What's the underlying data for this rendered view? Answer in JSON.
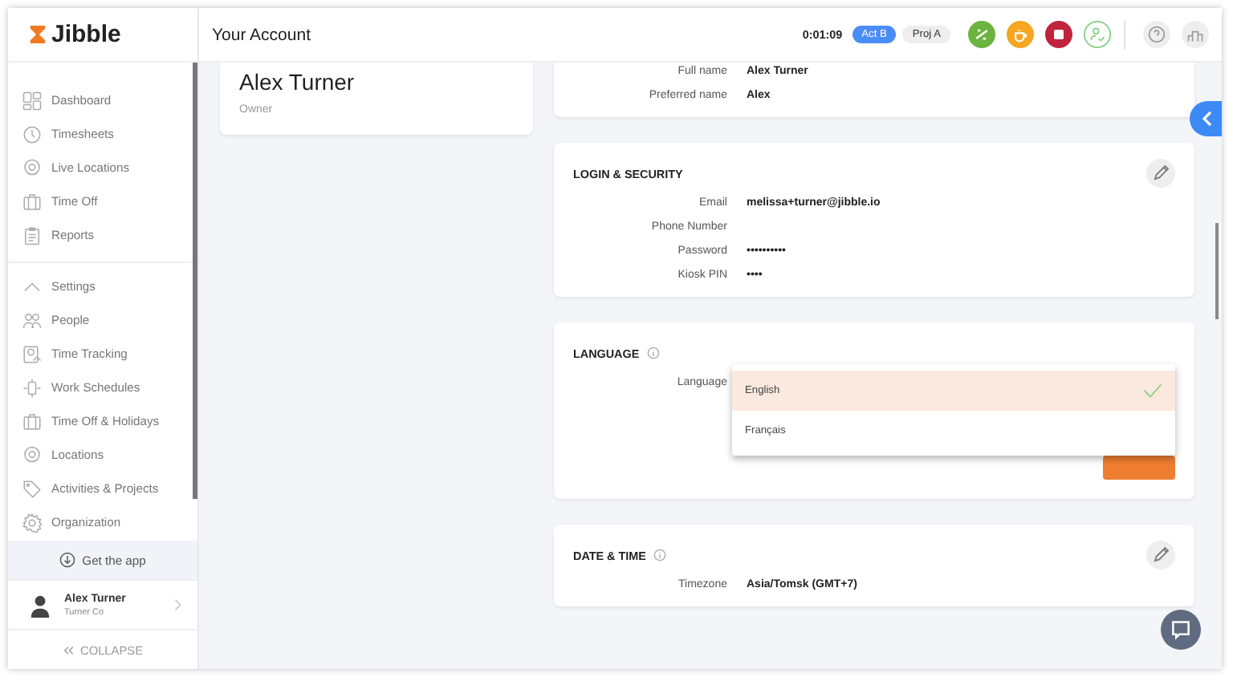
{
  "sidebar": {
    "logo": "Jibble",
    "nav": [
      {
        "label": "Dashboard"
      },
      {
        "label": "Timesheets"
      },
      {
        "label": "Live Locations"
      },
      {
        "label": "Time Off"
      },
      {
        "label": "Reports"
      }
    ],
    "settings": {
      "label": "Settings",
      "expanded": true,
      "items": [
        {
          "label": "People"
        },
        {
          "label": "Time Tracking"
        },
        {
          "label": "Work Schedules"
        },
        {
          "label": "Time Off & Holidays"
        },
        {
          "label": "Locations"
        },
        {
          "label": "Activities & Projects"
        },
        {
          "label": "Organization"
        }
      ]
    },
    "get_app": "Get the app",
    "user": {
      "name": "Alex Turner",
      "company": "Turner Co"
    },
    "collapse": "COLLAPSE"
  },
  "header": {
    "title": "Your Account",
    "timer": "0:01:09",
    "activity": "Act B",
    "project": "Proj A"
  },
  "profile": {
    "name": "Alex Turner",
    "role": "Owner"
  },
  "basic_info": {
    "rows": [
      {
        "label": "Full name",
        "value": "Alex Turner"
      },
      {
        "label": "Preferred name",
        "value": "Alex"
      }
    ]
  },
  "login_security": {
    "title": "LOGIN & SECURITY",
    "rows": [
      {
        "label": "Email",
        "value": "melissa+turner@jibble.io"
      },
      {
        "label": "Phone Number",
        "value": ""
      },
      {
        "label": "Password",
        "value": "••••••••••"
      },
      {
        "label": "Kiosk PIN",
        "value": "••••"
      }
    ]
  },
  "language": {
    "title": "LANGUAGE",
    "label": "Language",
    "options": [
      {
        "label": "English",
        "selected": true
      },
      {
        "label": "Français",
        "selected": false
      }
    ]
  },
  "date_time": {
    "title": "DATE & TIME",
    "rows": [
      {
        "label": "Timezone",
        "value": "Asia/Tomsk (GMT+7)"
      }
    ]
  }
}
